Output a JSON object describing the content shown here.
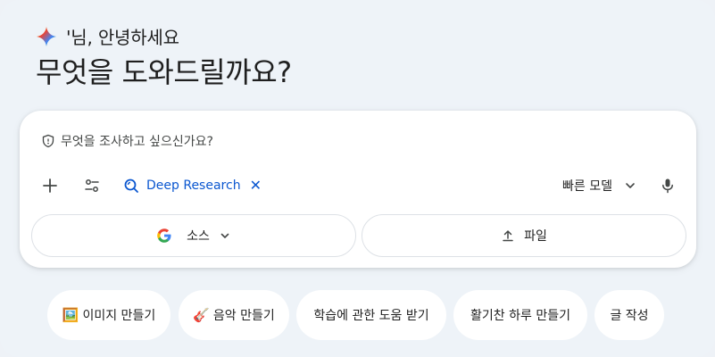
{
  "greeting": {
    "text": "'님, 안녕하세요",
    "headline": "무엇을 도와드릴까요?"
  },
  "composer": {
    "prompt": "무엇을 조사하고 싶으신가요?",
    "deep_research_label": "Deep Research",
    "deep_research_close": "✕",
    "model_label": "빠른 모델",
    "sources_label": "소스",
    "file_label": "파일"
  },
  "suggestions": [
    {
      "emoji": "🖼️",
      "label": "이미지 만들기"
    },
    {
      "emoji": "🎸",
      "label": "음악 만들기"
    },
    {
      "emoji": "",
      "label": "학습에 관한 도움 받기"
    },
    {
      "emoji": "",
      "label": "활기찬 하루 만들기"
    },
    {
      "emoji": "",
      "label": "글 작성"
    }
  ],
  "colors": {
    "accent": "#0b57d0",
    "background": "#eef3f8",
    "card": "#ffffff"
  }
}
